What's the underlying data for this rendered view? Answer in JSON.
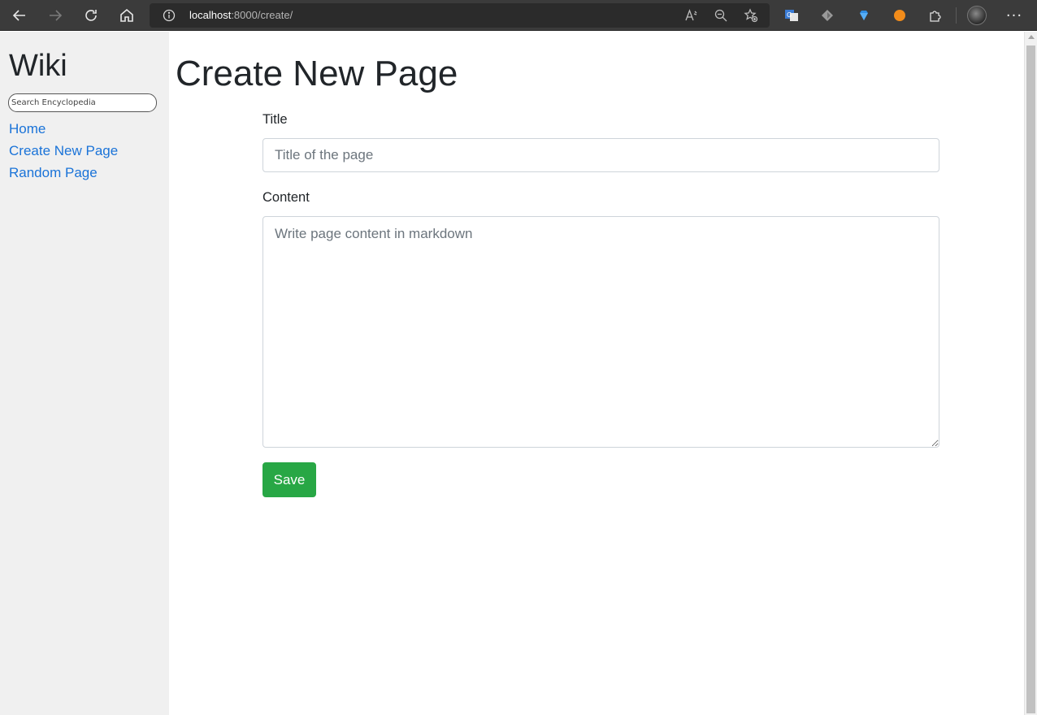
{
  "browser": {
    "url_host": "localhost",
    "url_rest": ":8000/create/",
    "icons": {
      "back": "back-arrow-icon",
      "forward": "forward-arrow-icon",
      "reload": "reload-icon",
      "home": "home-icon",
      "info": "info-icon",
      "read_aloud": "read-aloud-icon",
      "zoom_out": "zoom-out-icon",
      "favorites": "add-favorite-icon",
      "extensions": "extensions-puzzle-icon",
      "more": "more-dots-icon"
    }
  },
  "sidebar": {
    "title": "Wiki",
    "search_placeholder": "Search Encyclopedia",
    "links": [
      {
        "label": "Home"
      },
      {
        "label": "Create New Page"
      },
      {
        "label": "Random Page"
      }
    ]
  },
  "main": {
    "heading": "Create New Page",
    "title_label": "Title",
    "title_placeholder": "Title of the page",
    "content_label": "Content",
    "content_placeholder": "Write page content in markdown",
    "save_label": "Save"
  },
  "colors": {
    "link": "#1a73d8",
    "save_button": "#28a745",
    "sidebar_bg": "#f0f0f0"
  }
}
